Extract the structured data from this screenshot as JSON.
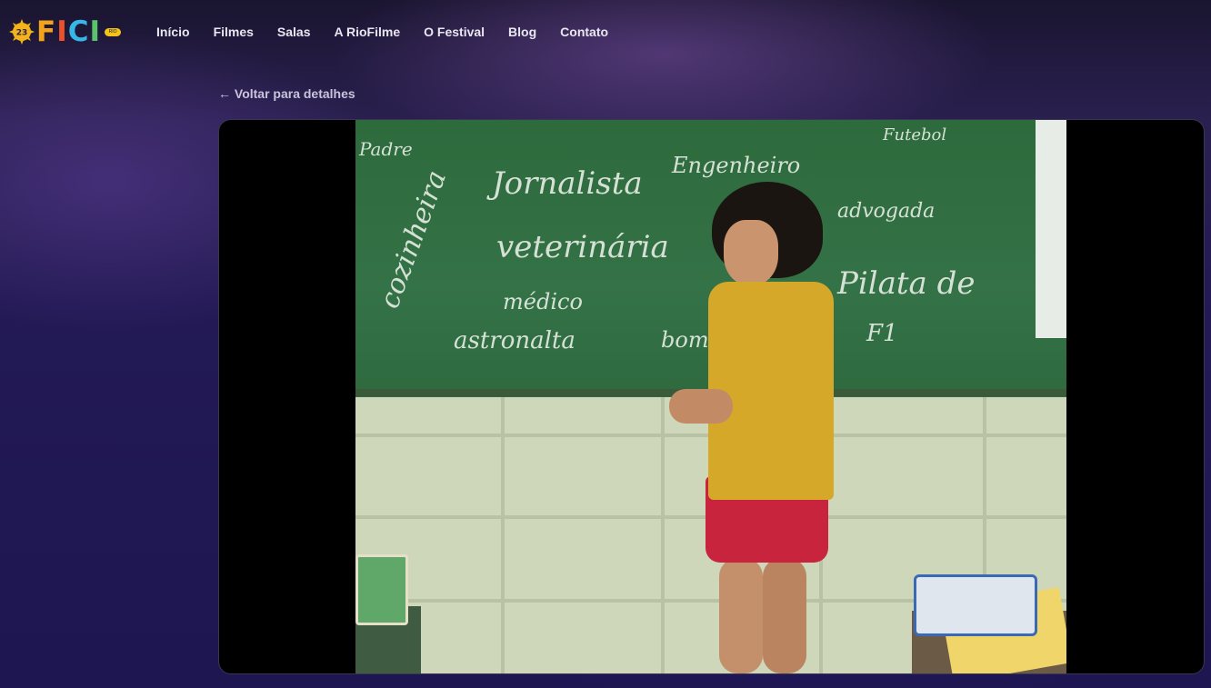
{
  "nav": {
    "logo": {
      "badge": "23",
      "letters": [
        "F",
        "I",
        "C",
        "I"
      ],
      "tag": "RIO"
    },
    "items": [
      {
        "label": "Início"
      },
      {
        "label": "Filmes"
      },
      {
        "label": "Salas"
      },
      {
        "label": "A RioFilme"
      },
      {
        "label": "O Festival"
      },
      {
        "label": "Blog"
      },
      {
        "label": "Contato"
      }
    ]
  },
  "back_link": "← Voltar para detalhes",
  "video": {
    "chalkboard_words": [
      "Padre",
      "Jornalista",
      "Engenheiro",
      "veterinária",
      "médico",
      "astronalta",
      "Pilata de",
      "F1",
      "cozinheira",
      "advogada",
      "Futebol",
      "bom"
    ]
  },
  "colors": {
    "logo_orange": "#f5a21b",
    "logo_red": "#e9522b",
    "logo_blue": "#37b7e7",
    "logo_green": "#59c26b",
    "background": "#231a55"
  }
}
